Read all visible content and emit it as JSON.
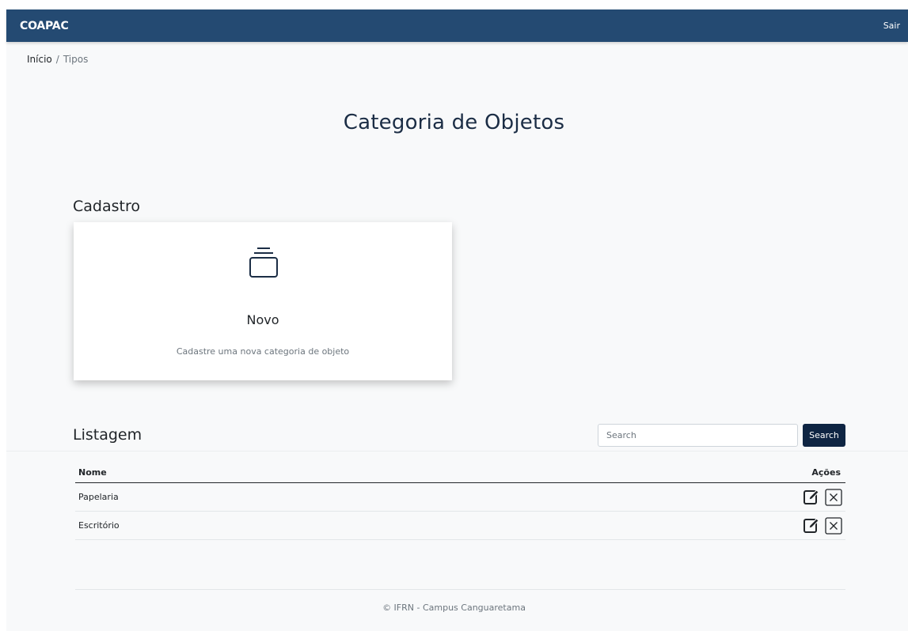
{
  "navbar": {
    "brand": "COAPAC",
    "logout_label": "Sair"
  },
  "breadcrumb": {
    "home": "Início",
    "separator": "/",
    "current": "Tipos"
  },
  "page_title": "Categoria de Objetos",
  "register_section": {
    "title": "Cadastro",
    "card": {
      "icon": "collection-icon",
      "title": "Novo",
      "description": "Cadastre uma nova categoria de objeto"
    }
  },
  "listing_section": {
    "title": "Listagem",
    "search": {
      "placeholder": "Search",
      "value": "",
      "button_label": "Search"
    },
    "table": {
      "columns": [
        "Nome",
        "Ações"
      ],
      "rows": [
        {
          "nome": "Papelaria",
          "actions": [
            "edit-icon",
            "delete-icon"
          ]
        },
        {
          "nome": "Escritório",
          "actions": [
            "edit-icon",
            "delete-icon"
          ]
        }
      ]
    }
  },
  "footer": {
    "text": "© IFRN - Campus Canguaretama"
  },
  "colors": {
    "navbar": "#244a72",
    "title": "#1b2d45",
    "search_button": "#0f2543",
    "background": "#f8f9fa"
  }
}
